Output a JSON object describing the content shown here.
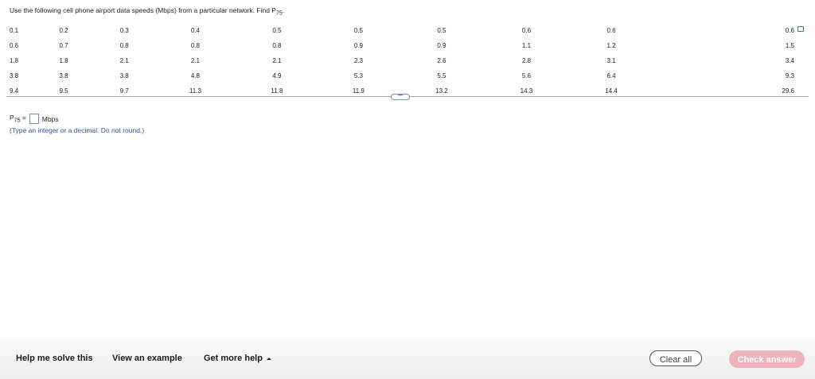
{
  "question": {
    "text": "Use the following cell phone airport data speeds (Mbps) from a particular network. Find P",
    "subscript": "75",
    "suffix": "."
  },
  "table": {
    "rows": [
      [
        "0.1",
        "0.2",
        "0.3",
        "0.4",
        "0.5",
        "0.5",
        "0.5",
        "0.6",
        "0.6",
        "0.6"
      ],
      [
        "0.6",
        "0.7",
        "0.8",
        "0.8",
        "0.8",
        "0.9",
        "0.9",
        "1.1",
        "1.2",
        "1.5"
      ],
      [
        "1.8",
        "1.8",
        "2.1",
        "2.1",
        "2.1",
        "2.3",
        "2.6",
        "2.8",
        "3.1",
        "3.4"
      ],
      [
        "3.8",
        "3.8",
        "3.8",
        "4.8",
        "4.9",
        "5.3",
        "5.5",
        "5.6",
        "6.4",
        "9.3"
      ],
      [
        "9.4",
        "9.5",
        "9.7",
        "11.3",
        "11.8",
        "11.9",
        "13.2",
        "14.3",
        "14.4",
        "29.6"
      ]
    ]
  },
  "more_button": {
    "label": "•••"
  },
  "answer": {
    "prefix": "P",
    "subscript": "75",
    "equals": " =",
    "unit": "Mbps",
    "hint": "(Type an integer or a decimal. Do not round.)"
  },
  "footer": {
    "help_me_solve": "Help me solve this",
    "view_example": "View an example",
    "get_more_help": "Get more help",
    "clear_all": "Clear all",
    "check_answer": "Check answer"
  }
}
